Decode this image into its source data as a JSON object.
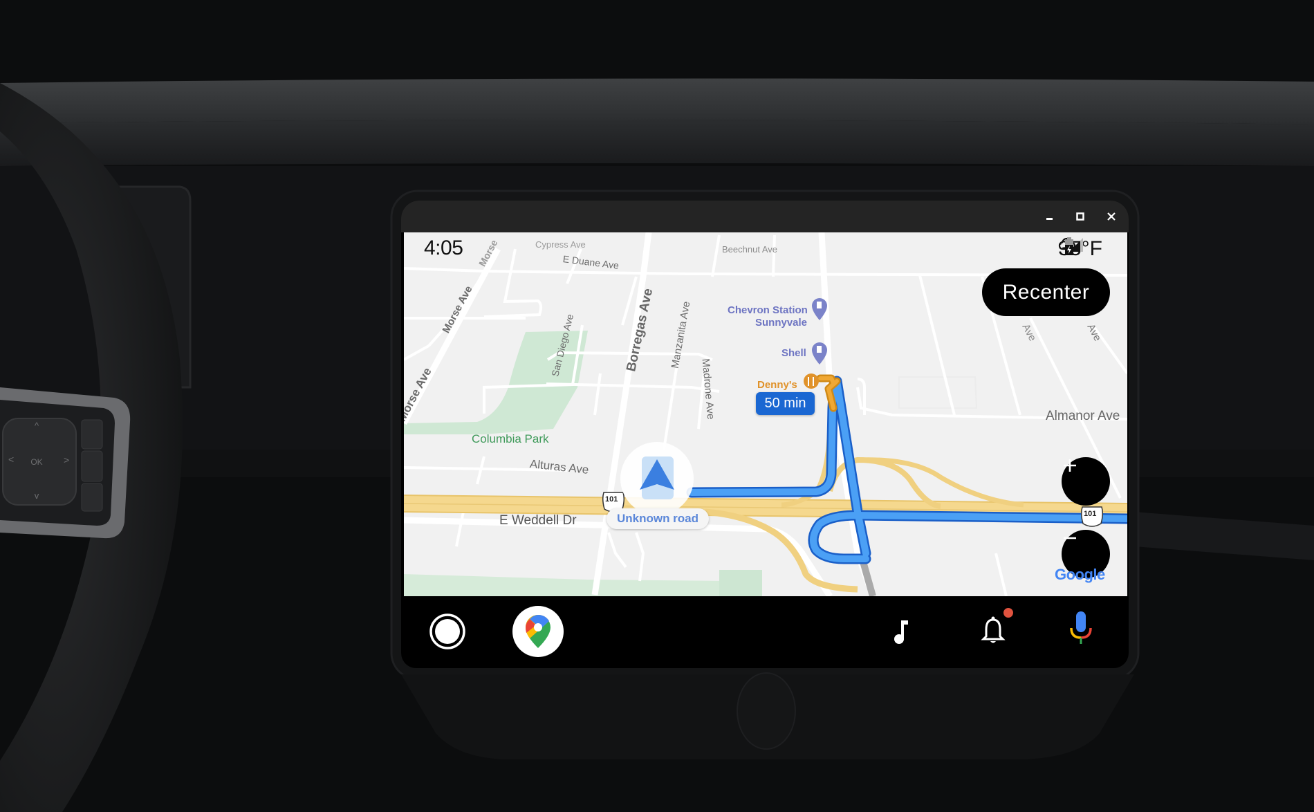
{
  "window": {
    "controls": [
      {
        "name": "minimize",
        "icon": "minimize-icon"
      },
      {
        "name": "maximize",
        "icon": "maximize-icon"
      },
      {
        "name": "close",
        "icon": "close-icon"
      }
    ]
  },
  "status_bar": {
    "time": "4:05",
    "weather_icon": "cloud-icon",
    "temperature": "35°F",
    "signal_icon": "cellular-signal-icon",
    "battery_icon": "battery-charging-icon"
  },
  "map": {
    "recenter_label": "Recenter",
    "zoom_in_icon": "plus-icon",
    "zoom_out_icon": "minus-icon",
    "eta_badge": "50 min",
    "current_road": "Unknown road",
    "highway_shield": "101",
    "attribution": "Google",
    "colors": {
      "route": "#4285f4",
      "route_outline": "#1a5fc8",
      "highway": "#f5d27a",
      "park": "#cfe8d4",
      "poi_gas": "#7b83c9",
      "poi_food": "#e0922a",
      "eta_bg": "#1a67d2"
    },
    "street_labels": {
      "cypress": "Cypress Ave",
      "e_duane": "E Duane Ave",
      "beechnut": "Beechnut Ave",
      "morse_1": "Morse Ave",
      "morse_2": "Morse Ave",
      "morse_3": "Morse",
      "san_diego": "San Diego Ave",
      "borregas": "Borregas Ave",
      "manzanita": "Manzanita Ave",
      "madrone": "Madrone Ave",
      "alturas": "Alturas Ave",
      "e_weddell": "E Weddell Dr",
      "almanor": "Almanor Ave",
      "ave_right_1": "Ave",
      "ave_right_2": "Ave"
    },
    "places": {
      "park": "Columbia Park",
      "chevron_line1": "Chevron Station",
      "chevron_line2": "Sunnyvale",
      "shell": "Shell",
      "dennys": "Denny's"
    }
  },
  "nav_bar": {
    "items": [
      {
        "name": "home",
        "icon": "home-circle-icon"
      },
      {
        "name": "google-maps",
        "icon": "google-maps-icon"
      },
      {
        "name": "media",
        "icon": "music-note-icon"
      },
      {
        "name": "notifications",
        "icon": "bell-icon",
        "has_badge": true,
        "badge_color": "#e0533f"
      },
      {
        "name": "assistant",
        "icon": "microphone-icon"
      }
    ]
  },
  "steering_controls": {
    "ok_label": "OK"
  }
}
